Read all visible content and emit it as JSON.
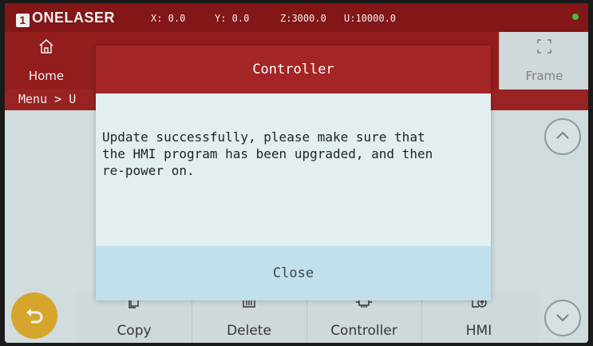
{
  "header": {
    "logo_badge": "1",
    "logo_text": "ONELASER",
    "x": "X:  0.0",
    "y": "Y:  0.0",
    "z": "Z:3000.0",
    "u": "U:10000.0",
    "status_color": "#3fcf3f"
  },
  "nav": {
    "home_label": "Home",
    "frame_label": "Frame"
  },
  "breadcrumb": "Menu > U",
  "bottom": {
    "copy_label": "Copy",
    "delete_label": "Delete",
    "controller_label": "Controller",
    "hmi_label": "HMI"
  },
  "dialog": {
    "title": "Controller",
    "message": "Update successfully, please make sure that\nthe HMI program has been upgraded, and then\nre-power on.",
    "close_label": "Close"
  },
  "colors": {
    "brand_red": "#9e1f1f",
    "back_button": "#e4b12f",
    "close_bar": "#bfe0ec"
  },
  "icons": [
    "home-icon",
    "frame-icon",
    "chevron-up-icon",
    "chevron-down-icon",
    "undo-icon",
    "copy-icon",
    "delete-icon",
    "controller-icon",
    "hmi-upload-icon"
  ]
}
